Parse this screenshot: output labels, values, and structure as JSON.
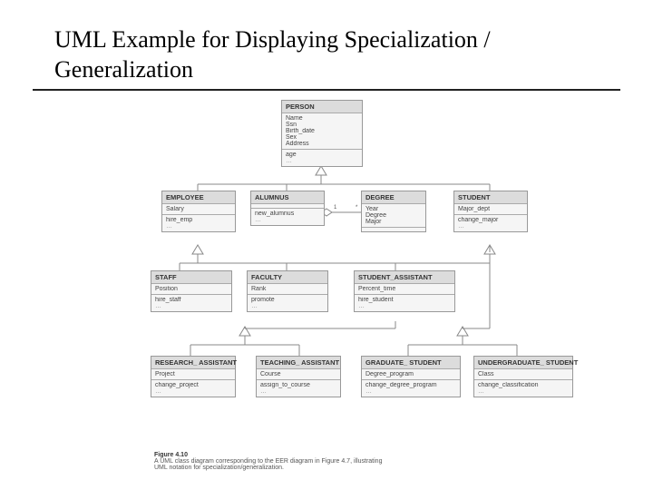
{
  "title": "UML Example for Displaying Specialization / Generalization",
  "caption": {
    "figLabel": "Figure 4.10",
    "line1": "A UML class diagram corresponding to the EER diagram in Figure 4.7, illustrating",
    "line2": "UML notation for specialization/generalization."
  },
  "classes": {
    "person": {
      "name": "PERSON",
      "attrs": [
        "Name",
        "Ssn",
        "Birth_date",
        "Sex",
        "Address"
      ],
      "ops": [
        "age"
      ],
      "extra": [
        "…"
      ]
    },
    "employee": {
      "name": "EMPLOYEE",
      "attrs": [
        "Salary"
      ],
      "ops": [
        "hire_emp"
      ],
      "extra": [
        "…"
      ]
    },
    "alumnus": {
      "name": "ALUMNUS",
      "attrs": [
        ""
      ],
      "ops": [
        "new_alumnus"
      ],
      "extra": [
        "…"
      ]
    },
    "degree": {
      "name": "DEGREE",
      "attrs": [
        "Year",
        "Degree",
        "Major"
      ],
      "ops": [
        ""
      ],
      "extra": []
    },
    "student": {
      "name": "STUDENT",
      "attrs": [
        "Major_dept"
      ],
      "ops": [
        "change_major"
      ],
      "extra": [
        "…"
      ]
    },
    "staff": {
      "name": "STAFF",
      "attrs": [
        "Position"
      ],
      "ops": [
        "hire_staff"
      ],
      "extra": [
        "…"
      ]
    },
    "faculty": {
      "name": "FACULTY",
      "attrs": [
        "Rank"
      ],
      "ops": [
        "promote"
      ],
      "extra": [
        "…"
      ]
    },
    "student_assistant": {
      "name": "STUDENT_ASSISTANT",
      "attrs": [
        "Percent_time"
      ],
      "ops": [
        "hire_student"
      ],
      "extra": [
        "…"
      ]
    },
    "research_assistant": {
      "name": "RESEARCH_ ASSISTANT",
      "attrs": [
        "Project"
      ],
      "ops": [
        "change_project"
      ],
      "extra": [
        "…"
      ]
    },
    "teaching_assistant": {
      "name": "TEACHING_ ASSISTANT",
      "attrs": [
        "Course"
      ],
      "ops": [
        "assign_to_course"
      ],
      "extra": [
        "…"
      ]
    },
    "graduate_student": {
      "name": "GRADUATE_ STUDENT",
      "attrs": [
        "Degree_program"
      ],
      "ops": [
        "change_degree_program"
      ],
      "extra": [
        "…"
      ]
    },
    "undergraduate_student": {
      "name": "UNDERGRADUATE_ STUDENT",
      "attrs": [
        "Class"
      ],
      "ops": [
        "change_classification"
      ],
      "extra": [
        "…"
      ]
    }
  },
  "assocLabels": {
    "one": "1",
    "star": "*"
  }
}
